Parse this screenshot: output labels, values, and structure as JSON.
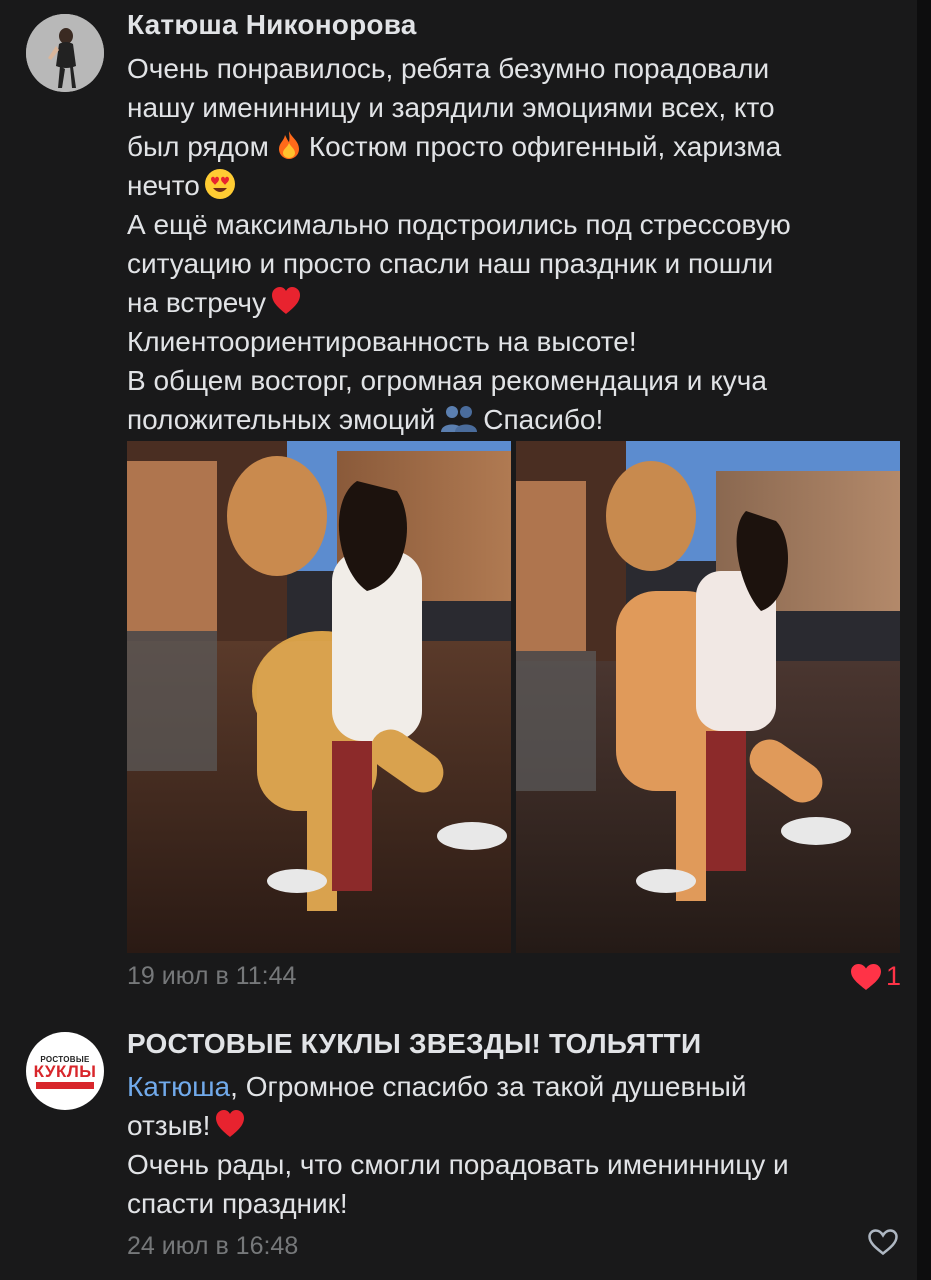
{
  "comments": [
    {
      "author": "Катюша Никонорова",
      "lines": [
        {
          "text": "Очень понравилось, ребята безумно порадовали"
        },
        {
          "text": "нашу именинницу и зарядили эмоциями всех, кто"
        },
        {
          "text": "был рядом",
          "emoji": "fire-emoji",
          "after": "Костюм просто офигенный, харизма"
        },
        {
          "text": "нечто",
          "emoji": "heart-eyes-emoji"
        },
        {
          "text": "А ещё максимально подстроились под стрессовую"
        },
        {
          "text": "ситуацию и просто спасли наш праздник и пошли"
        },
        {
          "text": "на встречу",
          "emoji": "red-heart-emoji"
        },
        {
          "text": "Клиентоориентированность на высоте!"
        },
        {
          "text": "В общем восторг, огромная рекомендация и куча"
        },
        {
          "text": "положительных эмоций",
          "emoji": "people-emoji",
          "after": "Спасибо!"
        }
      ],
      "date": "19 июл в 11:44",
      "likes": "1",
      "liked": true
    },
    {
      "author": "РОСТОВЫЕ КУКЛЫ ЗВЕЗДЫ! ТОЛЬЯТТИ",
      "avatar_logo": {
        "top": "РОСТОВЫЕ",
        "main": "КУКЛЫ"
      },
      "mention": "Катюша",
      "lines": [
        {
          "text": ", Огромное спасибо за такой душевный"
        },
        {
          "text": "отзыв!",
          "emoji": "red-heart-emoji"
        },
        {
          "text": "Очень рады, что смогли порадовать именинницу и"
        },
        {
          "text": "спасти праздник!"
        }
      ],
      "date": "24 июл в 16:48",
      "liked": false
    }
  ],
  "colors": {
    "background": "#19191a",
    "text": "#e1e3e6",
    "secondary": "#76787a",
    "mention": "#71aaeb",
    "like_active": "#ff3347"
  }
}
